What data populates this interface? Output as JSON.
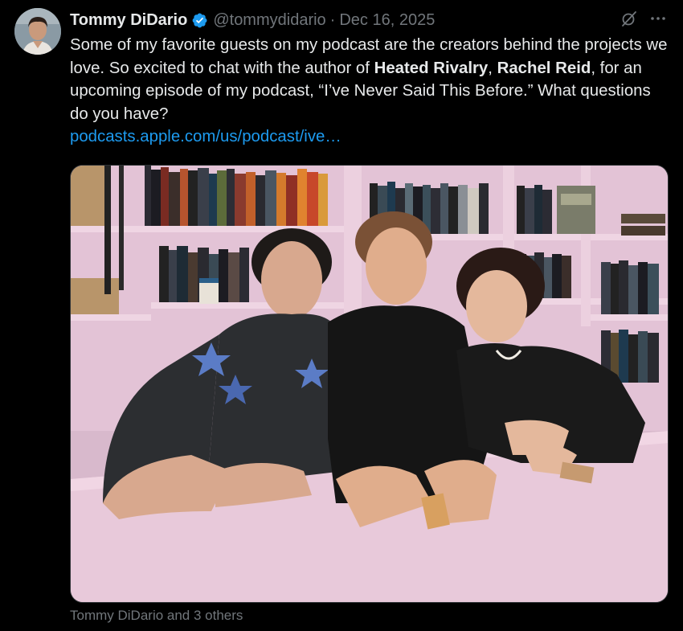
{
  "author": {
    "display_name": "Tommy DiDario",
    "handle": "@tommydidario",
    "separator": "·",
    "date": "Dec 16, 2025"
  },
  "body": {
    "part1": "Some of my favorite guests on my podcast are the creators behind the projects we love. So excited to chat with the author of ",
    "bold1": "Heated Rivalry",
    "part2": ", ",
    "bold2": "Rachel Reid",
    "part3": ", for an upcoming episode of my podcast, “I’ve Never Said This Before.” What questions do you have?",
    "link": "podcasts.apple.com/us/podcast/ive…"
  },
  "tagged": "Tommy DiDario and 3 others",
  "icons": {
    "verified": "verified-badge-icon",
    "grok": "grok-icon",
    "more": "more-icon"
  },
  "colors": {
    "background": "#000000",
    "text": "#e7e9ea",
    "muted": "#71767b",
    "link": "#1d9bf0",
    "verified": "#1d9bf0"
  }
}
